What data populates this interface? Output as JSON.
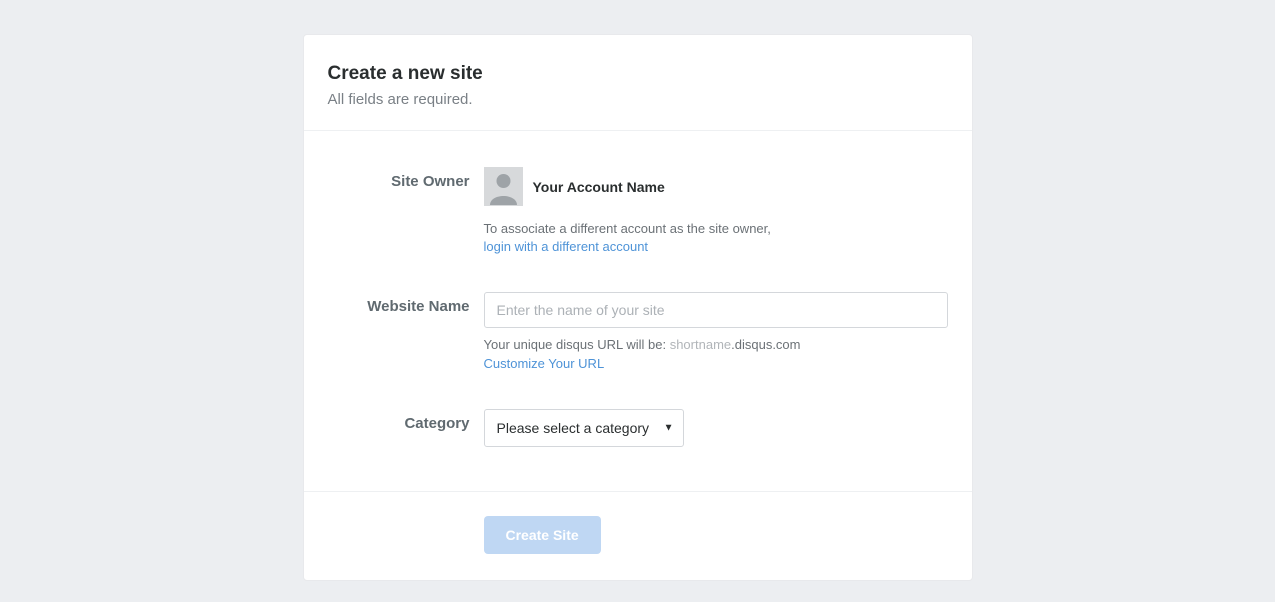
{
  "header": {
    "title": "Create a new site",
    "subtitle": "All fields are required."
  },
  "form": {
    "siteOwner": {
      "label": "Site Owner",
      "accountName": "Your Account Name",
      "helpText": "To associate a different account as the site owner,",
      "loginLink": "login with a different account"
    },
    "websiteName": {
      "label": "Website Name",
      "placeholder": "Enter the name of your site",
      "urlPrefix": "Your unique disqus URL will be: ",
      "shortname": "shortname",
      "urlSuffix": ".disqus.com",
      "customizeLink": "Customize Your URL"
    },
    "category": {
      "label": "Category",
      "placeholder": "Please select a category"
    }
  },
  "footer": {
    "submitLabel": "Create Site"
  }
}
